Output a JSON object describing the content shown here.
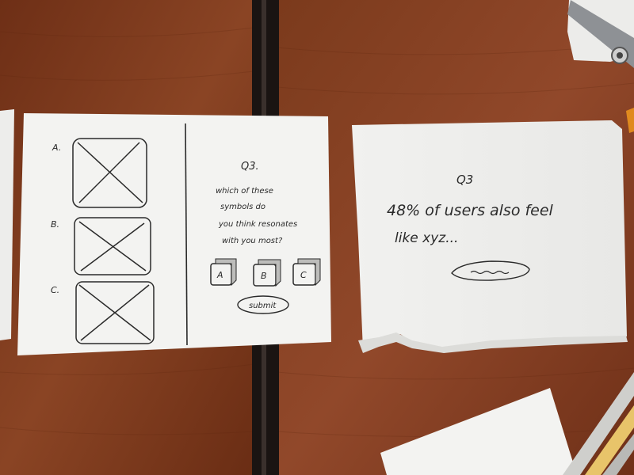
{
  "left_card": {
    "options": [
      {
        "letter": "A."
      },
      {
        "letter": "B."
      },
      {
        "letter": "C."
      }
    ],
    "question_title": "Q3.",
    "question_lines": [
      "which of these",
      "symbols do",
      "you think resonates",
      "with you most?"
    ],
    "answer_buttons": [
      "A",
      "B",
      "C"
    ],
    "submit_label": "submit"
  },
  "right_card": {
    "title": "Q3",
    "result_line1": "48% of users also feel",
    "result_line2": "like xyz...",
    "scribble_label": "~~~~"
  },
  "colors": {
    "table": "#7a3a1c",
    "paper": "#f4f4f2",
    "ink": "#2a2a2a"
  }
}
